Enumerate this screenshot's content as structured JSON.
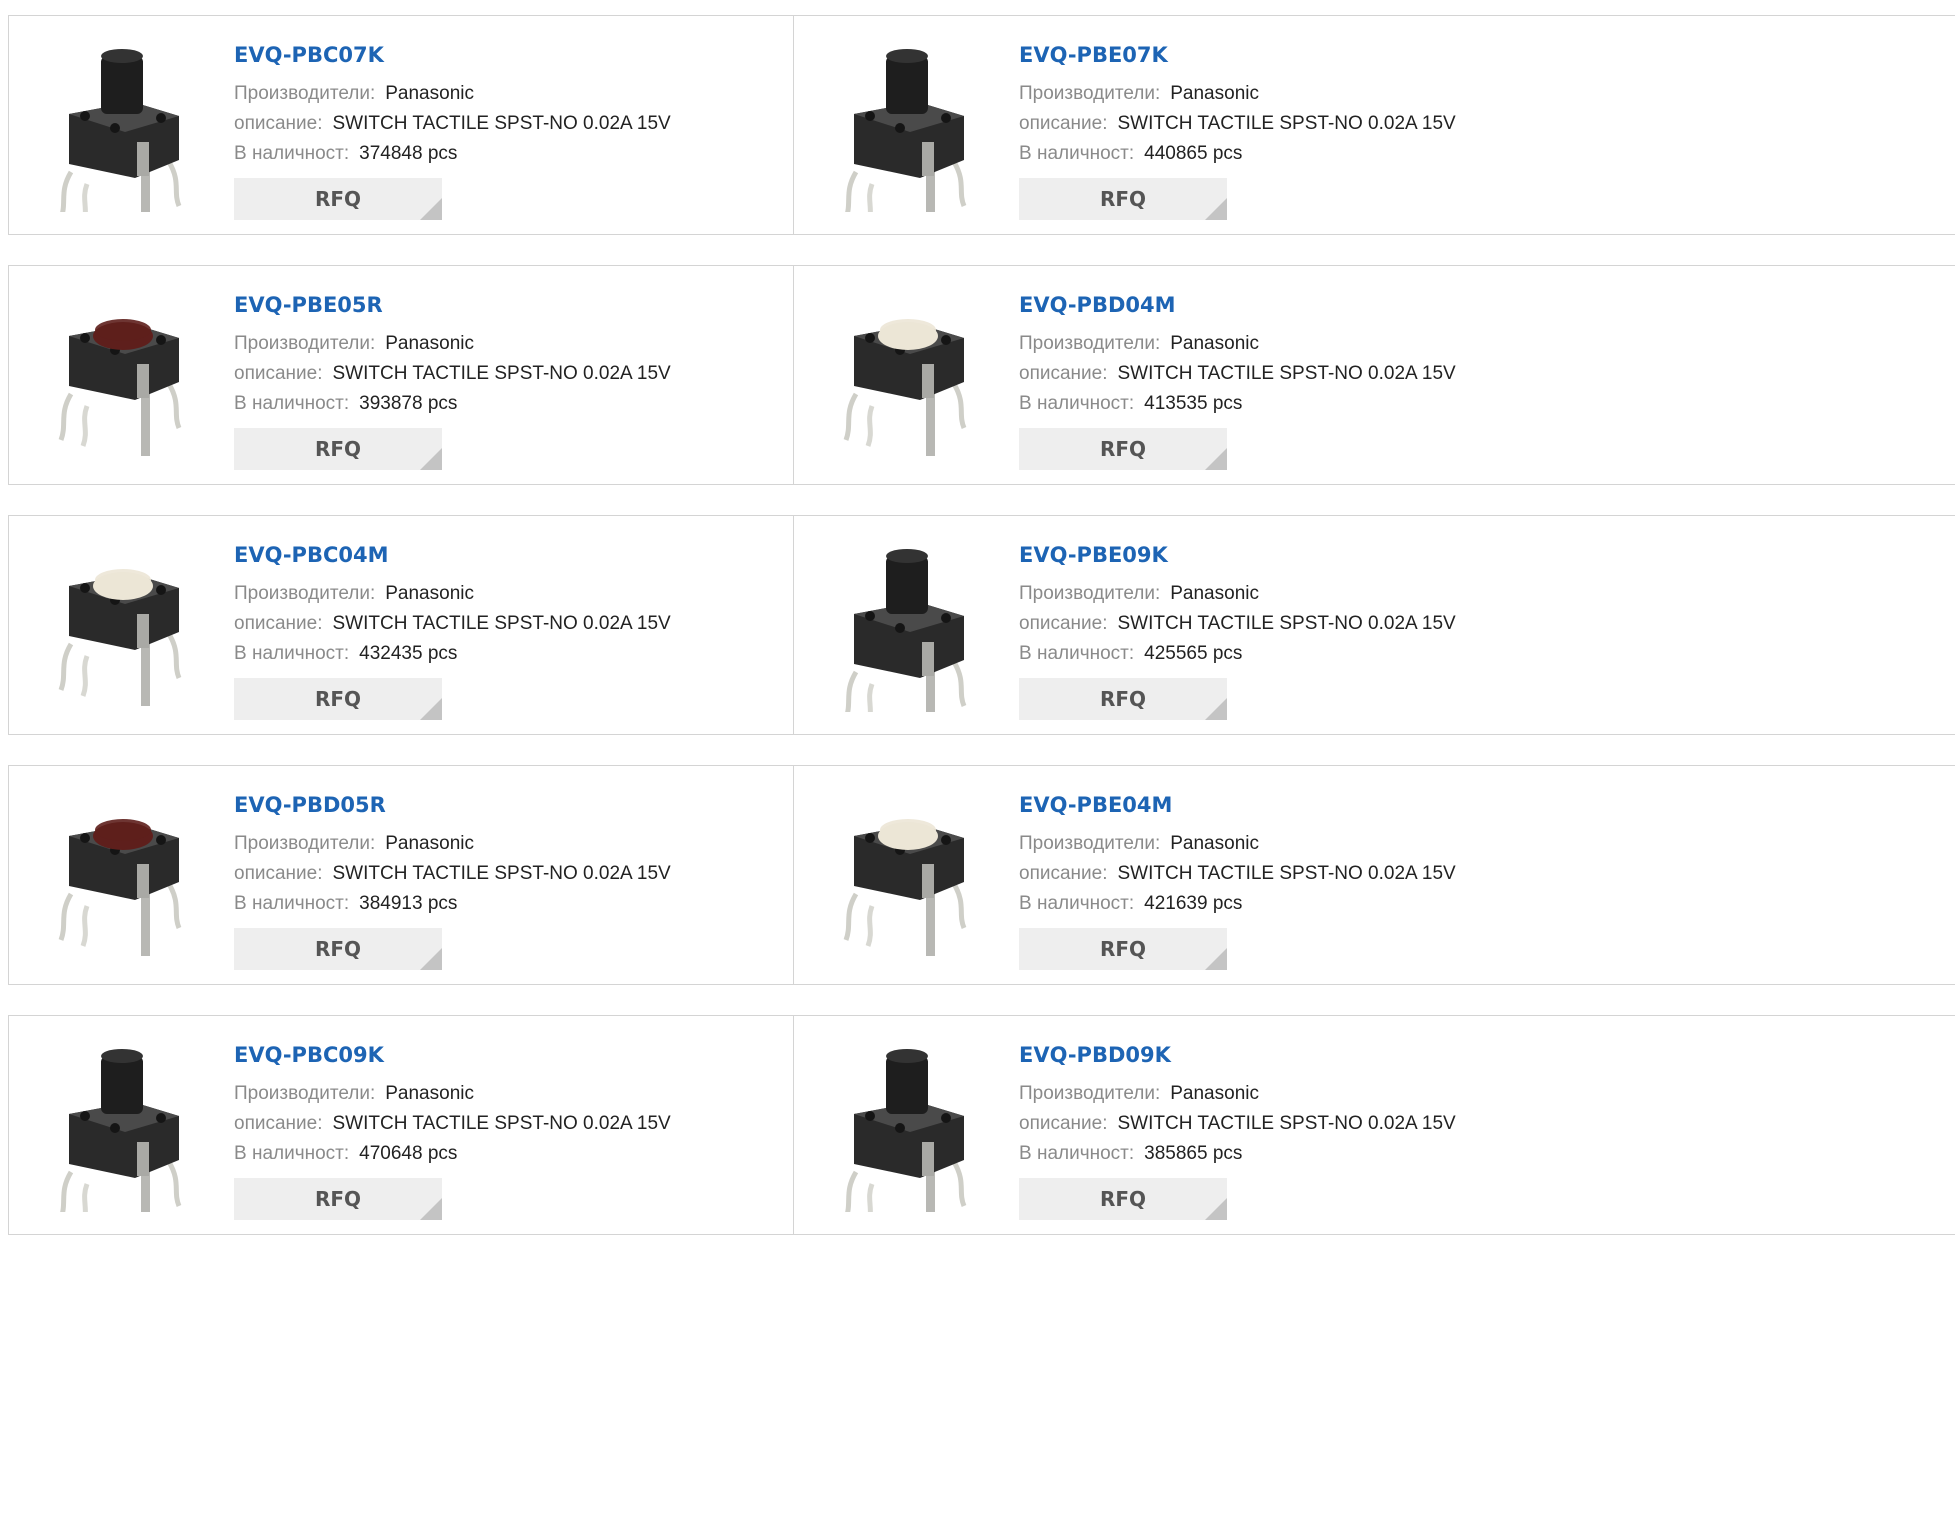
{
  "labels": {
    "manufacturer": "Производители:",
    "description": "описание:",
    "stock": "В наличност:",
    "rfq": "RFQ"
  },
  "products": [
    {
      "part": "EVQ-PBC07K",
      "manufacturer": "Panasonic",
      "description": "SWITCH TACTILE SPST-NO 0.02A 15V",
      "stock": "374848 pcs",
      "image": "tactile-switch-tall-black-icon"
    },
    {
      "part": "EVQ-PBE07K",
      "manufacturer": "Panasonic",
      "description": "SWITCH TACTILE SPST-NO 0.02A 15V",
      "stock": "440865 pcs",
      "image": "tactile-switch-tall-black-icon"
    },
    {
      "part": "EVQ-PBE05R",
      "manufacturer": "Panasonic",
      "description": "SWITCH TACTILE SPST-NO 0.02A 15V",
      "stock": "393878 pcs",
      "image": "tactile-switch-red-icon"
    },
    {
      "part": "EVQ-PBD04M",
      "manufacturer": "Panasonic",
      "description": "SWITCH TACTILE SPST-NO 0.02A 15V",
      "stock": "413535 pcs",
      "image": "tactile-switch-white-icon"
    },
    {
      "part": "EVQ-PBC04M",
      "manufacturer": "Panasonic",
      "description": "SWITCH TACTILE SPST-NO 0.02A 15V",
      "stock": "432435 pcs",
      "image": "tactile-switch-white-icon"
    },
    {
      "part": "EVQ-PBE09K",
      "manufacturer": "Panasonic",
      "description": "SWITCH TACTILE SPST-NO 0.02A 15V",
      "stock": "425565 pcs",
      "image": "tactile-switch-tall-black-icon"
    },
    {
      "part": "EVQ-PBD05R",
      "manufacturer": "Panasonic",
      "description": "SWITCH TACTILE SPST-NO 0.02A 15V",
      "stock": "384913 pcs",
      "image": "tactile-switch-red-icon"
    },
    {
      "part": "EVQ-PBE04M",
      "manufacturer": "Panasonic",
      "description": "SWITCH TACTILE SPST-NO 0.02A 15V",
      "stock": "421639 pcs",
      "image": "tactile-switch-white-icon"
    },
    {
      "part": "EVQ-PBC09K",
      "manufacturer": "Panasonic",
      "description": "SWITCH TACTILE SPST-NO 0.02A 15V",
      "stock": "470648 pcs",
      "image": "tactile-switch-tall-black-icon"
    },
    {
      "part": "EVQ-PBD09K",
      "manufacturer": "Panasonic",
      "description": "SWITCH TACTILE SPST-NO 0.02A 15V",
      "stock": "385865 pcs",
      "image": "tactile-switch-tall-black-icon"
    }
  ],
  "colors": {
    "title": "#1d64b4",
    "label": "#8a8a8a",
    "value": "#222222",
    "border": "#d4d4d4",
    "rfq_bg": "#eeeeee",
    "rfq_corner": "#c4c4c4",
    "cap_black": "#1e1e1e",
    "cap_red": "#5e1f1c",
    "cap_white": "#ece6d6"
  }
}
